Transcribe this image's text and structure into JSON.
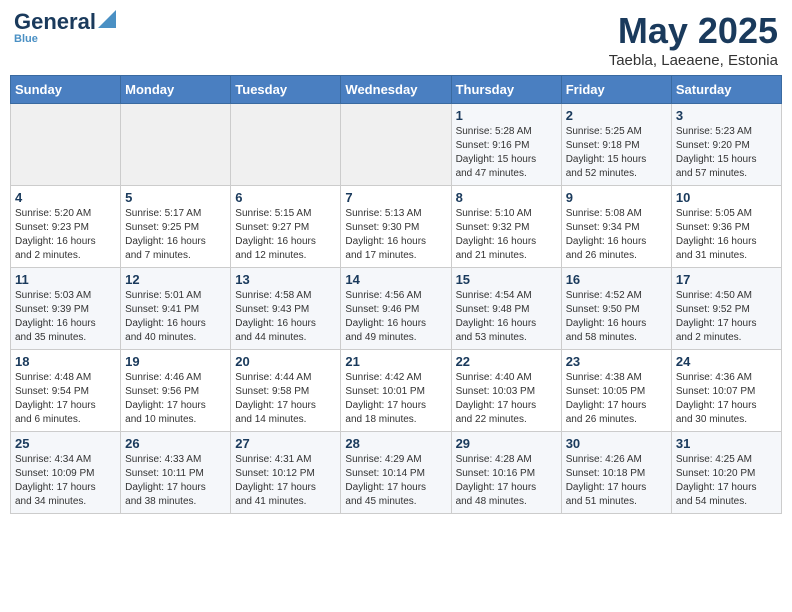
{
  "header": {
    "logo_main": "General",
    "logo_sub": "Blue",
    "title": "May 2025",
    "subtitle": "Taebla, Laeaene, Estonia"
  },
  "weekdays": [
    "Sunday",
    "Monday",
    "Tuesday",
    "Wednesday",
    "Thursday",
    "Friday",
    "Saturday"
  ],
  "weeks": [
    [
      {
        "day": "",
        "info": ""
      },
      {
        "day": "",
        "info": ""
      },
      {
        "day": "",
        "info": ""
      },
      {
        "day": "",
        "info": ""
      },
      {
        "day": "1",
        "info": "Sunrise: 5:28 AM\nSunset: 9:16 PM\nDaylight: 15 hours\nand 47 minutes."
      },
      {
        "day": "2",
        "info": "Sunrise: 5:25 AM\nSunset: 9:18 PM\nDaylight: 15 hours\nand 52 minutes."
      },
      {
        "day": "3",
        "info": "Sunrise: 5:23 AM\nSunset: 9:20 PM\nDaylight: 15 hours\nand 57 minutes."
      }
    ],
    [
      {
        "day": "4",
        "info": "Sunrise: 5:20 AM\nSunset: 9:23 PM\nDaylight: 16 hours\nand 2 minutes."
      },
      {
        "day": "5",
        "info": "Sunrise: 5:17 AM\nSunset: 9:25 PM\nDaylight: 16 hours\nand 7 minutes."
      },
      {
        "day": "6",
        "info": "Sunrise: 5:15 AM\nSunset: 9:27 PM\nDaylight: 16 hours\nand 12 minutes."
      },
      {
        "day": "7",
        "info": "Sunrise: 5:13 AM\nSunset: 9:30 PM\nDaylight: 16 hours\nand 17 minutes."
      },
      {
        "day": "8",
        "info": "Sunrise: 5:10 AM\nSunset: 9:32 PM\nDaylight: 16 hours\nand 21 minutes."
      },
      {
        "day": "9",
        "info": "Sunrise: 5:08 AM\nSunset: 9:34 PM\nDaylight: 16 hours\nand 26 minutes."
      },
      {
        "day": "10",
        "info": "Sunrise: 5:05 AM\nSunset: 9:36 PM\nDaylight: 16 hours\nand 31 minutes."
      }
    ],
    [
      {
        "day": "11",
        "info": "Sunrise: 5:03 AM\nSunset: 9:39 PM\nDaylight: 16 hours\nand 35 minutes."
      },
      {
        "day": "12",
        "info": "Sunrise: 5:01 AM\nSunset: 9:41 PM\nDaylight: 16 hours\nand 40 minutes."
      },
      {
        "day": "13",
        "info": "Sunrise: 4:58 AM\nSunset: 9:43 PM\nDaylight: 16 hours\nand 44 minutes."
      },
      {
        "day": "14",
        "info": "Sunrise: 4:56 AM\nSunset: 9:46 PM\nDaylight: 16 hours\nand 49 minutes."
      },
      {
        "day": "15",
        "info": "Sunrise: 4:54 AM\nSunset: 9:48 PM\nDaylight: 16 hours\nand 53 minutes."
      },
      {
        "day": "16",
        "info": "Sunrise: 4:52 AM\nSunset: 9:50 PM\nDaylight: 16 hours\nand 58 minutes."
      },
      {
        "day": "17",
        "info": "Sunrise: 4:50 AM\nSunset: 9:52 PM\nDaylight: 17 hours\nand 2 minutes."
      }
    ],
    [
      {
        "day": "18",
        "info": "Sunrise: 4:48 AM\nSunset: 9:54 PM\nDaylight: 17 hours\nand 6 minutes."
      },
      {
        "day": "19",
        "info": "Sunrise: 4:46 AM\nSunset: 9:56 PM\nDaylight: 17 hours\nand 10 minutes."
      },
      {
        "day": "20",
        "info": "Sunrise: 4:44 AM\nSunset: 9:58 PM\nDaylight: 17 hours\nand 14 minutes."
      },
      {
        "day": "21",
        "info": "Sunrise: 4:42 AM\nSunset: 10:01 PM\nDaylight: 17 hours\nand 18 minutes."
      },
      {
        "day": "22",
        "info": "Sunrise: 4:40 AM\nSunset: 10:03 PM\nDaylight: 17 hours\nand 22 minutes."
      },
      {
        "day": "23",
        "info": "Sunrise: 4:38 AM\nSunset: 10:05 PM\nDaylight: 17 hours\nand 26 minutes."
      },
      {
        "day": "24",
        "info": "Sunrise: 4:36 AM\nSunset: 10:07 PM\nDaylight: 17 hours\nand 30 minutes."
      }
    ],
    [
      {
        "day": "25",
        "info": "Sunrise: 4:34 AM\nSunset: 10:09 PM\nDaylight: 17 hours\nand 34 minutes."
      },
      {
        "day": "26",
        "info": "Sunrise: 4:33 AM\nSunset: 10:11 PM\nDaylight: 17 hours\nand 38 minutes."
      },
      {
        "day": "27",
        "info": "Sunrise: 4:31 AM\nSunset: 10:12 PM\nDaylight: 17 hours\nand 41 minutes."
      },
      {
        "day": "28",
        "info": "Sunrise: 4:29 AM\nSunset: 10:14 PM\nDaylight: 17 hours\nand 45 minutes."
      },
      {
        "day": "29",
        "info": "Sunrise: 4:28 AM\nSunset: 10:16 PM\nDaylight: 17 hours\nand 48 minutes."
      },
      {
        "day": "30",
        "info": "Sunrise: 4:26 AM\nSunset: 10:18 PM\nDaylight: 17 hours\nand 51 minutes."
      },
      {
        "day": "31",
        "info": "Sunrise: 4:25 AM\nSunset: 10:20 PM\nDaylight: 17 hours\nand 54 minutes."
      }
    ]
  ]
}
